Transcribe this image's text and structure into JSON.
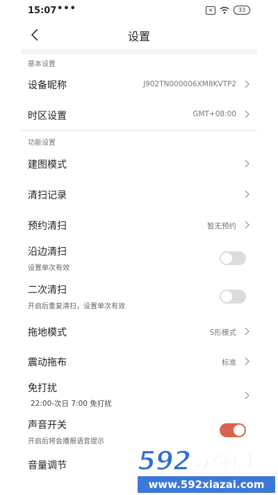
{
  "status_bar": {
    "time": "15:07",
    "dots": "•••",
    "sim": "×",
    "battery": "33"
  },
  "header": {
    "title": "设置",
    "back_icon": "back-chevron-icon"
  },
  "sections": {
    "basic": "基本设置",
    "function": "功能设置"
  },
  "rows": {
    "device_name": {
      "label": "设备昵称",
      "value": "J902TN000006XM8KVTP2"
    },
    "timezone": {
      "label": "时区设置",
      "value": "GMT+08:00"
    },
    "map_mode": {
      "label": "建图模式"
    },
    "clean_record": {
      "label": "清扫记录"
    },
    "schedule": {
      "label": "预约清扫",
      "value": "暂无预约"
    },
    "edge_clean": {
      "label": "沿边清扫",
      "sub": "设置单次有效",
      "enabled": false
    },
    "second_clean": {
      "label": "二次清扫",
      "sub": "开启后重复清扫，设置单次有效",
      "enabled": false
    },
    "mop_mode": {
      "label": "拖地模式",
      "value": "S形模式"
    },
    "vibrate_mop": {
      "label": "震动拖布",
      "value": "标准"
    },
    "dnd": {
      "label": "免打扰",
      "sub": "22:00-次日 7:00 免打扰"
    },
    "sound": {
      "label": "声音开关",
      "sub": "开启后将会播报语音提示",
      "enabled": true
    },
    "volume": {
      "label": "音量调节"
    }
  },
  "colors": {
    "toggle_on": "#d7644f",
    "toggle_off": "#dcdcdc",
    "watermark_blue": "#3c78d8"
  },
  "watermark": {
    "logo_number": "592",
    "logo_text": "软件园",
    "url": "www.592xiazai.com"
  }
}
